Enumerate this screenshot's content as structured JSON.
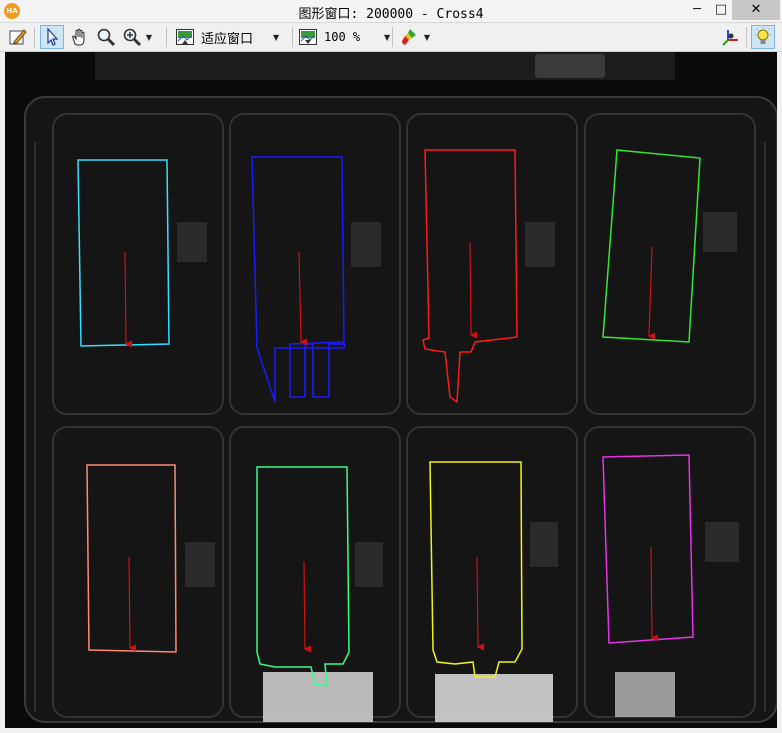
{
  "window": {
    "title": "图形窗口: 200000 - Cross4",
    "logo_text": "HA",
    "minimize_glyph": "─",
    "maximize_glyph": "□",
    "close_glyph": "✕"
  },
  "toolbar": {
    "zoom_mode_label": "适应窗口",
    "zoom_percent_label": "100 %",
    "icons": [
      "edit-icon",
      "pointer-icon",
      "pan-hand-icon",
      "magnifier-icon",
      "zoom-in-icon",
      "fit-window-icon",
      "zoom-percent-icon",
      "paint-brush-icon",
      "3d-axis-icon",
      "lightbulb-icon"
    ]
  },
  "colors": {
    "contour_cyan": "#33e0ff",
    "contour_blue": "#1a1aff",
    "contour_red": "#ff1a1a",
    "contour_green": "#33e633",
    "contour_salmon": "#ff8a70",
    "contour_springgreen": "#33ff88",
    "contour_yellow": "#f2f21a",
    "contour_magenta": "#e633e6",
    "arrow_red": "#d01010"
  }
}
